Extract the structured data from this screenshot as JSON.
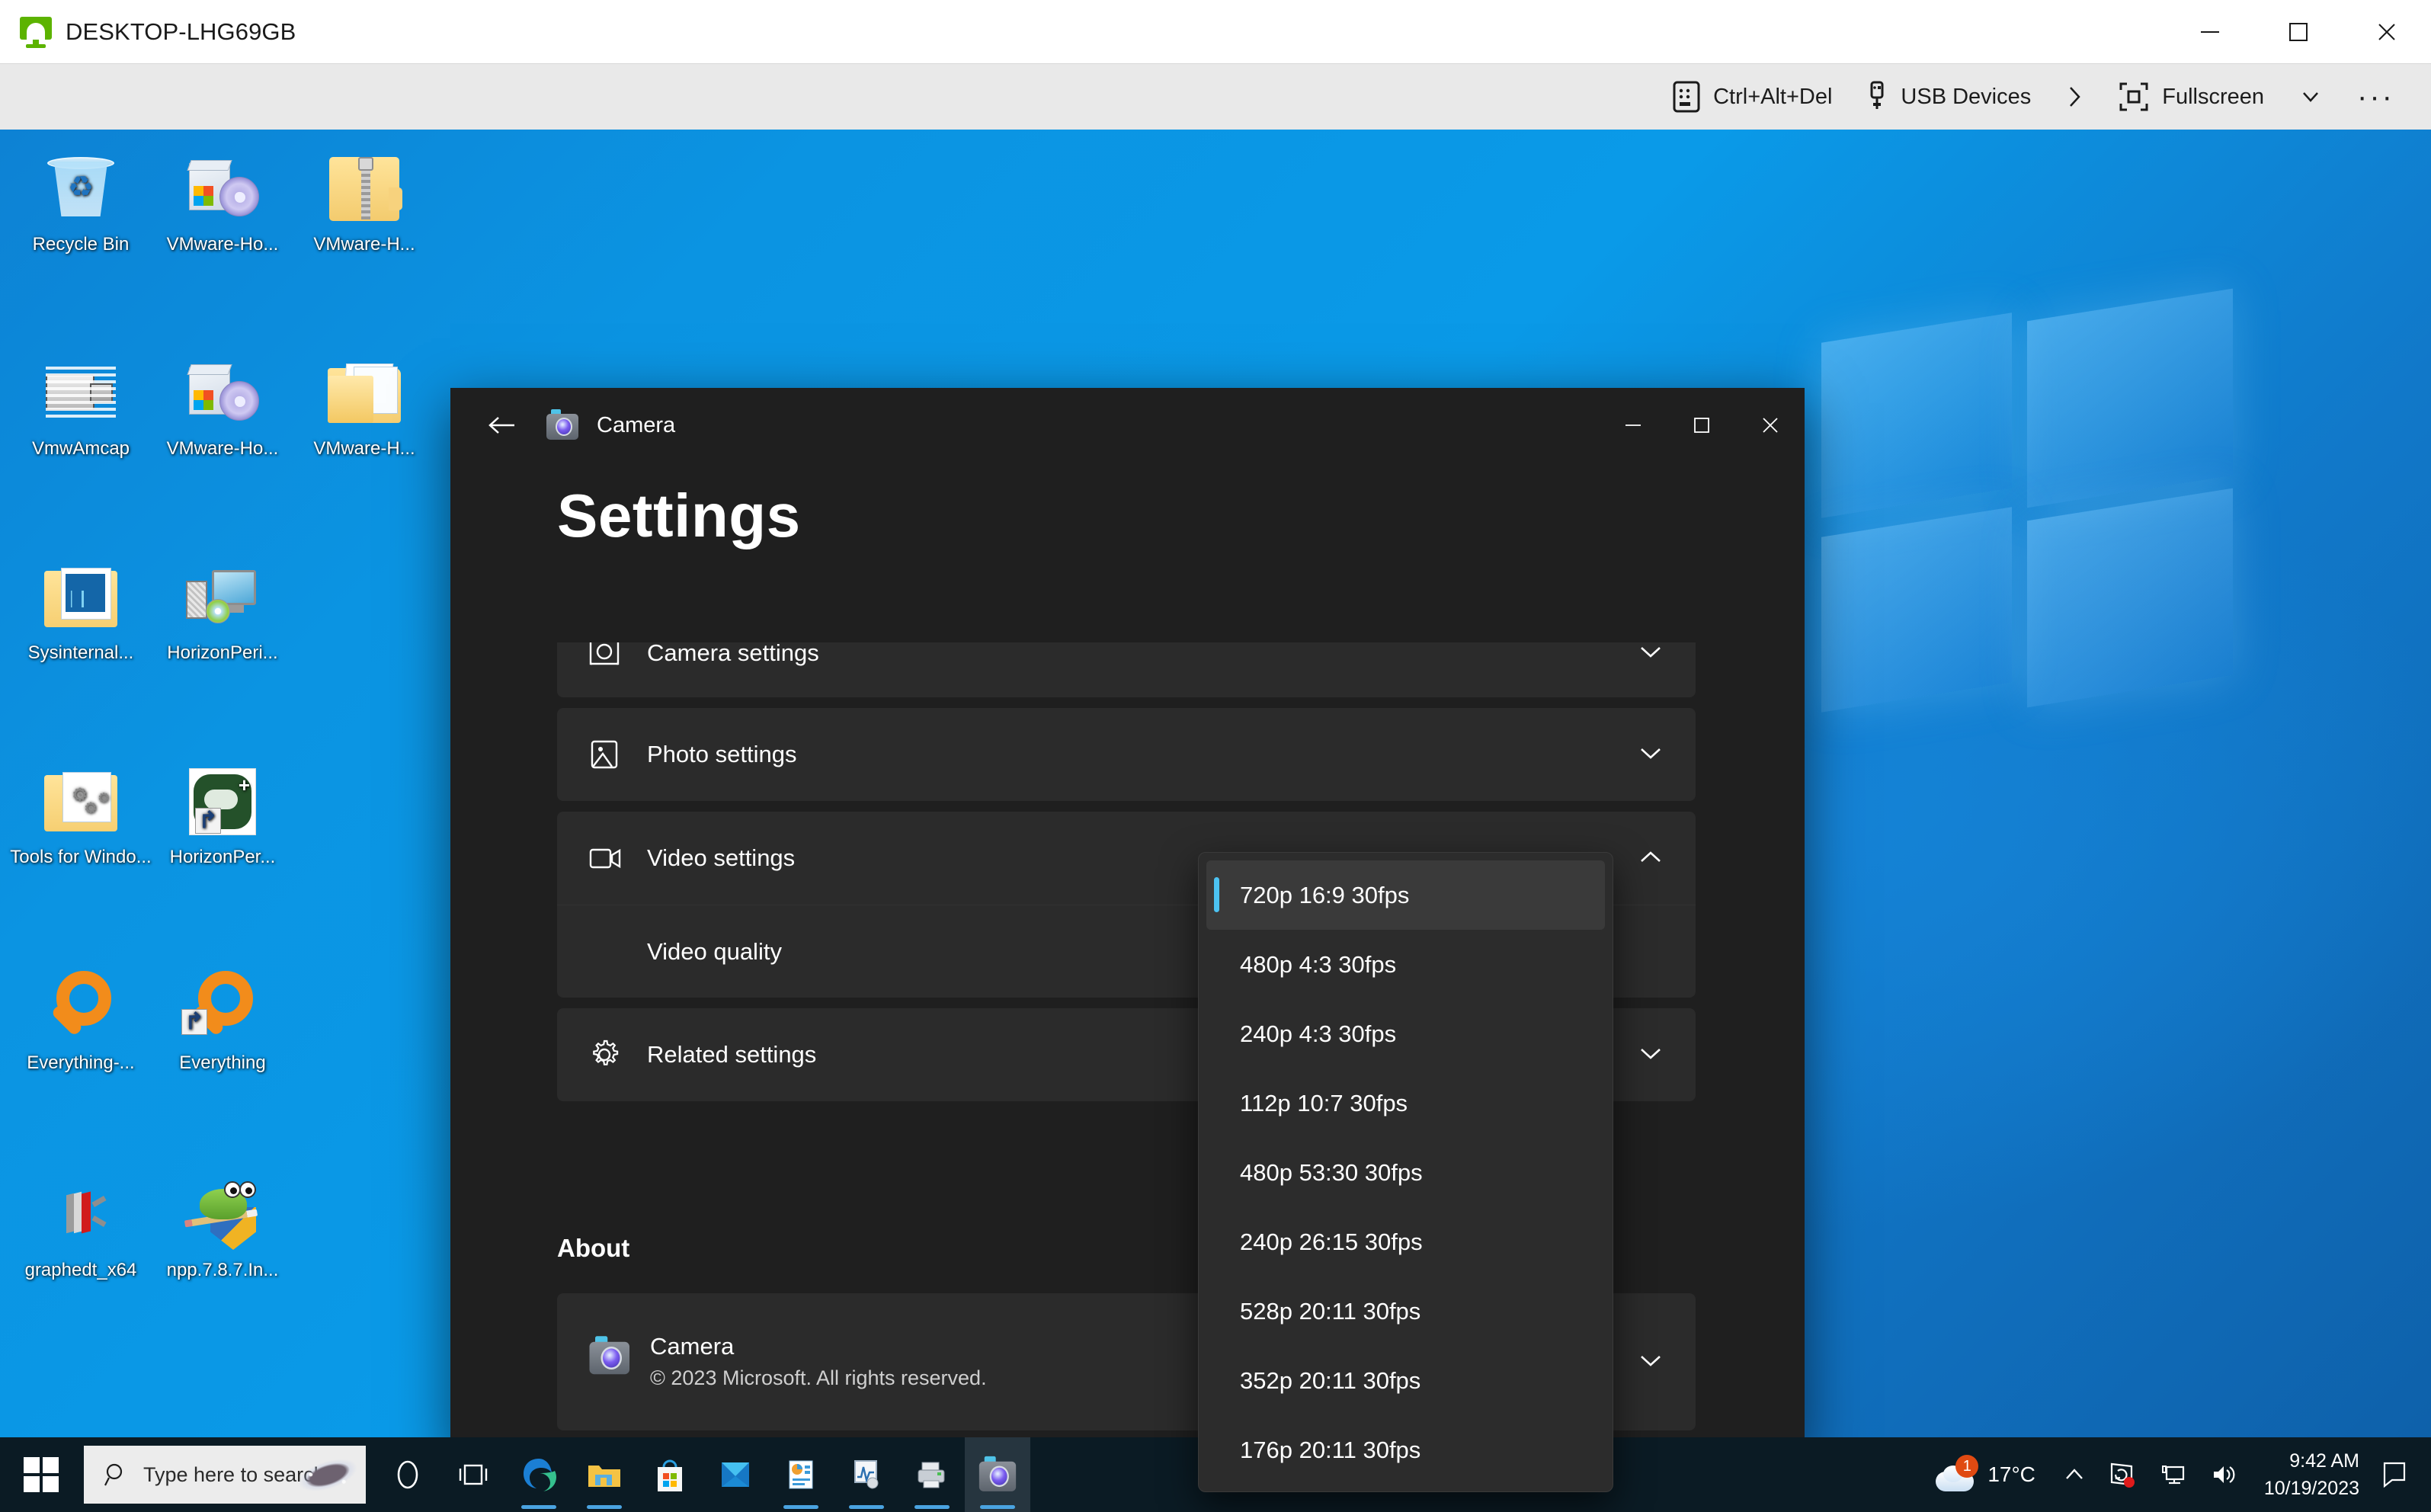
{
  "vm_console": {
    "host_name": "DESKTOP-LHG69GB",
    "host_icon": "monitor-green-icon",
    "window_controls": {
      "minimize": "minimize-icon",
      "maximize": "maximize-icon",
      "close": "close-icon"
    },
    "toolbar": {
      "ctrl_alt_del": "Ctrl+Alt+Del",
      "usb_devices": "USB Devices",
      "chevron_right": "chevron-right-icon",
      "fullscreen": "Fullscreen",
      "chevron_down": "chevron-down-icon",
      "more": "···"
    }
  },
  "desktop": {
    "icons": [
      {
        "label": "Recycle Bin",
        "icon": "recycle-bin-icon",
        "col": 0,
        "row": 0
      },
      {
        "label": "VMware-Ho...",
        "icon": "disc-installer-icon",
        "col": 1,
        "row": 0
      },
      {
        "label": "VMware-H...",
        "icon": "zip-folder-icon",
        "col": 2,
        "row": 0
      },
      {
        "label": "VmwAmcap",
        "icon": "camcorder-icon",
        "col": 0,
        "row": 1
      },
      {
        "label": "VMware-Ho...",
        "icon": "disc-installer-icon",
        "col": 1,
        "row": 1
      },
      {
        "label": "VMware-H...",
        "icon": "folder-icon",
        "col": 2,
        "row": 1
      },
      {
        "label": "Sysinternal...",
        "icon": "folder-chart-icon",
        "col": 0,
        "row": 2
      },
      {
        "label": "HorizonPeri...",
        "icon": "monitor-setup-icon",
        "col": 1,
        "row": 2
      },
      {
        "label": "Tools for Windo...",
        "icon": "folder-gears-icon",
        "col": 0,
        "row": 3
      },
      {
        "label": "HorizonPer...",
        "icon": "green-cloud-icon",
        "col": 1,
        "row": 3
      },
      {
        "label": "Everything-...",
        "icon": "magnifier-icon",
        "col": 0,
        "row": 4
      },
      {
        "label": "Everything",
        "icon": "magnifier-shortcut-icon",
        "col": 1,
        "row": 4
      },
      {
        "label": "graphedt_x64",
        "icon": "graphedt-icon",
        "col": 0,
        "row": 5
      },
      {
        "label": "npp.7.8.7.In...",
        "icon": "notepadpp-installer-icon",
        "col": 1,
        "row": 5
      }
    ]
  },
  "camera_app": {
    "titlebar": {
      "back": "back-arrow-icon",
      "app_icon": "camera-app-icon",
      "title": "Camera",
      "minimize": "minimize-icon",
      "maximize": "maximize-icon",
      "close": "close-icon"
    },
    "page_title": "Settings",
    "sections": [
      {
        "label": "Camera settings",
        "icon": "camera-outline-icon",
        "chevron": "chevron-down-icon",
        "expanded": false
      },
      {
        "label": "Photo settings",
        "icon": "photo-icon",
        "chevron": "chevron-down-icon",
        "expanded": false
      },
      {
        "label": "Video settings",
        "icon": "video-camera-icon",
        "chevron": "chevron-up-icon",
        "expanded": true
      },
      {
        "label": "Related settings",
        "icon": "gear-icon",
        "chevron": "chevron-down-icon",
        "expanded": false
      }
    ],
    "video_sub_row": {
      "label": "Video quality"
    },
    "about": {
      "heading": "About",
      "app_name": "Camera",
      "copyright": "© 2023 Microsoft. All rights reserved.",
      "chevron": "chevron-down-icon"
    },
    "video_quality_dropdown": {
      "selected": "720p 16:9 30fps",
      "accent_color": "#4cc2f1",
      "options": [
        "720p 16:9 30fps",
        "480p 4:3 30fps",
        "240p 4:3 30fps",
        "112p 10:7 30fps",
        "480p 53:30 30fps",
        "240p 26:15 30fps",
        "528p 20:11 30fps",
        "352p 20:11 30fps",
        "176p 20:11 30fps"
      ]
    }
  },
  "taskbar": {
    "start": "windows-start-icon",
    "search_placeholder": "Type here to search",
    "search_icon": "search-icon",
    "apps": [
      {
        "name": "cortana-icon",
        "running": false,
        "active": false
      },
      {
        "name": "task-view-icon",
        "running": false,
        "active": false
      },
      {
        "name": "edge-icon",
        "running": true,
        "active": false
      },
      {
        "name": "file-explorer-icon",
        "running": true,
        "active": false
      },
      {
        "name": "microsoft-store-icon",
        "running": false,
        "active": false
      },
      {
        "name": "mail-icon",
        "running": false,
        "active": false
      },
      {
        "name": "office-icon",
        "running": true,
        "active": false
      },
      {
        "name": "performance-monitor-icon",
        "running": true,
        "active": false
      },
      {
        "name": "printer-icon",
        "running": true,
        "active": false
      },
      {
        "name": "camera-icon",
        "running": true,
        "active": true
      }
    ],
    "tray": {
      "weather_temp": "17°C",
      "weather_badge": "1",
      "show_hidden": "chevron-up-icon",
      "vmware_tray": "vmware-tray-icon",
      "network": "network-icon",
      "volume": "volume-icon",
      "time": "9:42 AM",
      "date": "10/19/2023",
      "action_center": "action-center-icon"
    }
  }
}
